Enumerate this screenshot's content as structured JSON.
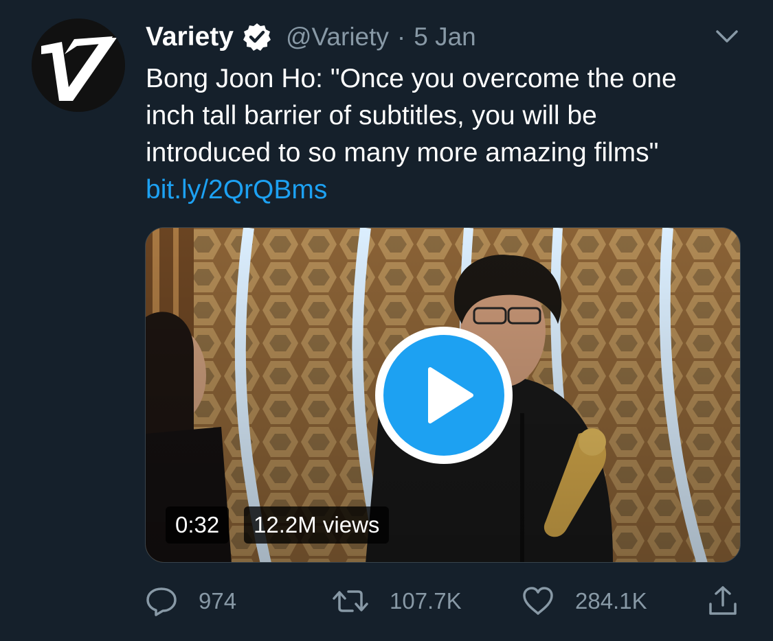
{
  "tweet": {
    "display_name": "Variety",
    "handle": "@Variety",
    "separator": "·",
    "date": "5 Jan",
    "text_lines": [
      "Bong Joon Ho: \"Once you overcome the one",
      "inch tall barrier of subtitles, you will be",
      "introduced to so many more amazing films\""
    ],
    "link": "bit.ly/2QrQBms",
    "avatar_letter": "V"
  },
  "media": {
    "duration": "0:32",
    "views": "12.2M views"
  },
  "actions": {
    "replies": "974",
    "retweets": "107.7K",
    "likes": "284.1K"
  },
  "colors": {
    "background": "#15202b",
    "accent": "#1da1f2",
    "secondary_text": "#8899a6"
  },
  "icons": [
    "verified-badge-icon",
    "chevron-down-icon",
    "play-icon",
    "reply-icon",
    "retweet-icon",
    "like-icon",
    "share-icon"
  ]
}
